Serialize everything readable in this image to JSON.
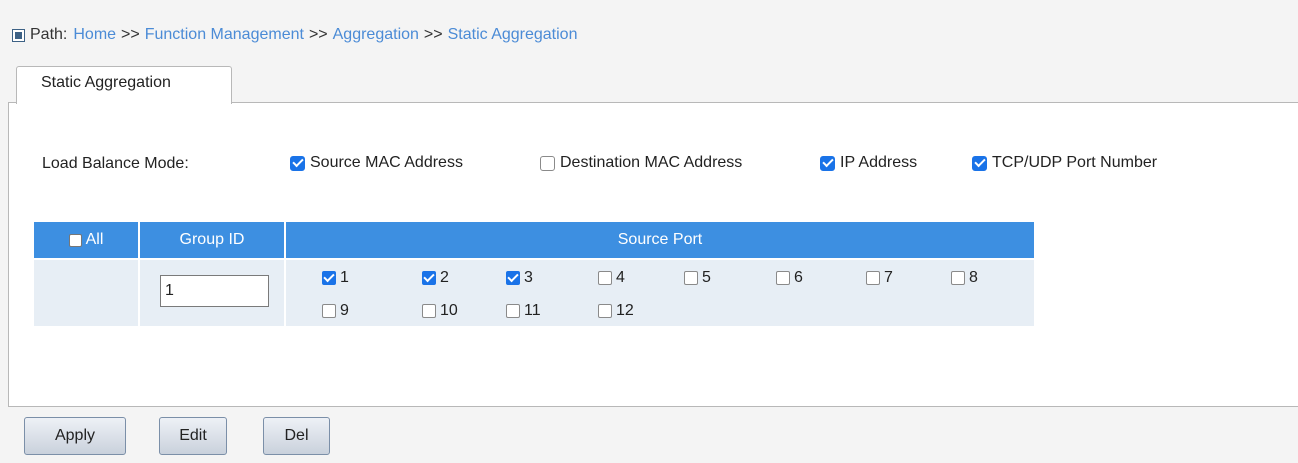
{
  "breadcrumb": {
    "label": "Path:",
    "items": [
      "Home",
      "Function Management",
      "Aggregation",
      "Static Aggregation"
    ],
    "separator": ">>"
  },
  "tab": {
    "label": "Static Aggregation"
  },
  "load_balance": {
    "label": "Load Balance Mode:",
    "options": [
      {
        "label": "Source MAC Address",
        "checked": true
      },
      {
        "label": "Destination MAC Address",
        "checked": false
      },
      {
        "label": "IP Address",
        "checked": true
      },
      {
        "label": "TCP/UDP Port Number",
        "checked": true
      }
    ]
  },
  "table": {
    "headers": {
      "all": "All",
      "group_id": "Group ID",
      "source_port": "Source Port"
    },
    "all_checked": false,
    "group_id_value": "1",
    "ports": [
      {
        "label": "1",
        "checked": true
      },
      {
        "label": "2",
        "checked": true
      },
      {
        "label": "3",
        "checked": true
      },
      {
        "label": "4",
        "checked": false
      },
      {
        "label": "5",
        "checked": false
      },
      {
        "label": "6",
        "checked": false
      },
      {
        "label": "7",
        "checked": false
      },
      {
        "label": "8",
        "checked": false
      },
      {
        "label": "9",
        "checked": false
      },
      {
        "label": "10",
        "checked": false
      },
      {
        "label": "11",
        "checked": false
      },
      {
        "label": "12",
        "checked": false
      }
    ]
  },
  "buttons": {
    "apply": "Apply",
    "edit": "Edit",
    "del": "Del"
  },
  "colors": {
    "header_blue": "#3d8fe1",
    "link_blue": "#4b8bd6",
    "checkbox_blue": "#1a73e8",
    "row_bg": "#e7eef5"
  }
}
